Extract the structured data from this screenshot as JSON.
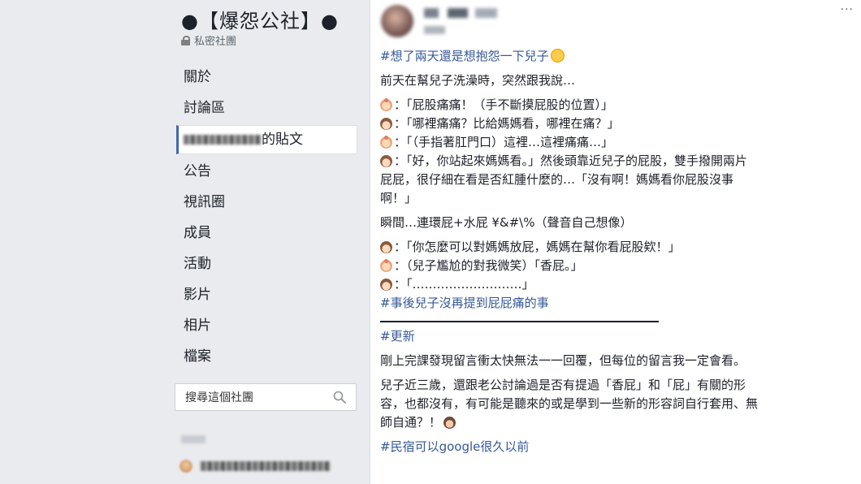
{
  "sidebar": {
    "group_name": "●【爆怨公社】●",
    "privacy": "私密社團",
    "nav": [
      {
        "label": "關於"
      },
      {
        "label": "討論區"
      },
      {
        "label": "的貼文"
      },
      {
        "label": "公告"
      },
      {
        "label": "視訊圈"
      },
      {
        "label": "成員"
      },
      {
        "label": "活動"
      },
      {
        "label": "影片"
      },
      {
        "label": "相片"
      },
      {
        "label": "檔案"
      }
    ],
    "search_placeholder": "搜尋這個社團"
  },
  "post": {
    "more": "···",
    "lines": {
      "hashtag1": "#想了兩天還是想抱怨一下兒子",
      "intro": "前天在幫兒子洗澡時，突然跟我說…",
      "d1": "：「屁股痛痛！（手不斷摸屁股的位置）」",
      "d2": "：「哪裡痛痛？比給媽媽看，哪裡在痛？」",
      "d3": "：「（手指著肛門口）這裡…這裡痛痛…」",
      "d4a": "：「好，你站起來媽媽看。」然後頭靠近兒子的屁股，雙手撥開兩片",
      "d4b": "屁屁，很仔細在看是否紅腫什麼的…「沒有啊！媽媽看你屁股沒事",
      "d4c": "啊！」",
      "moment": "瞬間…連環屁+水屁 ¥&#\\%（聲音自己想像）",
      "d5": "：「你怎麼可以對媽媽放屁，媽媽在幫你看屁股欸！」",
      "d6": "：（兒子尷尬的對我微笑）「香屁。」",
      "d7": "：「………………………」",
      "hashtag2": "#事後兒子沒再提到屁屁痛的事",
      "hashtag3": "#更新",
      "update1": "剛上完課發現留言衝太快無法一一回覆，但每位的留言我一定會看。",
      "update2a": "兒子近三歲，還跟老公討論過是否有提過「香屁」和「屁」有關的形",
      "update2b": "容，也都沒有，有可能是聽來的或是學到一些新的形容詞自行套用、無",
      "update2c": "師自通？！",
      "hashtag4": "#民宿可以google很久以前"
    }
  }
}
